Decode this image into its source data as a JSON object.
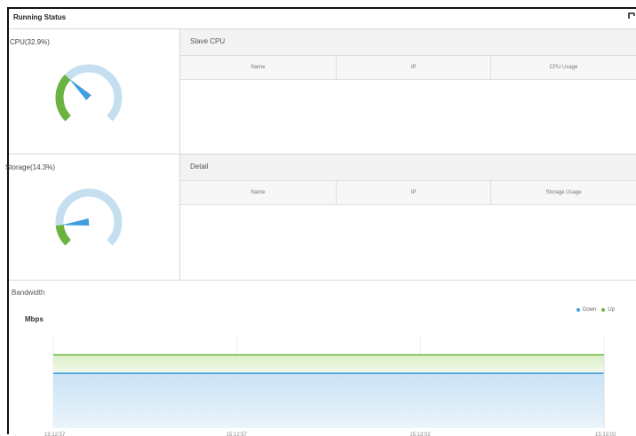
{
  "panel": {
    "title": "Running Status"
  },
  "cpu_gauge": {
    "label": "CPU(32.9%)",
    "percent": 32.9
  },
  "storage_gauge": {
    "label": "Storage(14.3%)",
    "percent": 14.3
  },
  "slave_cpu": {
    "title": "Slave CPU",
    "columns": [
      "Name",
      "IP",
      "CPU Usage"
    ],
    "rows": []
  },
  "detail": {
    "title": "Detail",
    "columns": [
      "Name",
      "IP",
      "Storage Usage"
    ],
    "rows": []
  },
  "bandwidth": {
    "title": "Bandwidth",
    "unit": "Mbps",
    "legend": [
      "Down",
      "Up"
    ],
    "colors": {
      "down": "#3f9ee0",
      "up": "#6bb33f",
      "gauge_fill": "#6bb33f",
      "gauge_track": "#c6dff0",
      "needle": "#3f9ee0"
    },
    "chart_data": {
      "type": "area",
      "x": [
        "15:12:57",
        "15:12:57",
        "15:13:02",
        "15:13:02"
      ],
      "series": [
        {
          "name": "Down",
          "values": [
            3,
            3,
            3,
            3
          ]
        },
        {
          "name": "Up",
          "values": [
            4,
            4,
            4,
            4
          ]
        }
      ],
      "ylim": [
        0,
        5
      ]
    }
  }
}
